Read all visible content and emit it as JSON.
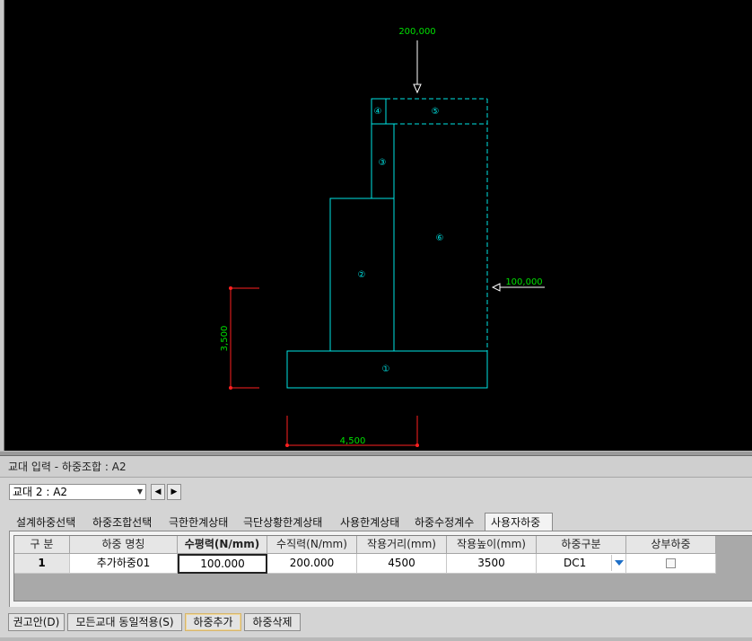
{
  "drawing": {
    "top_load": "200,000",
    "side_load": "100,000",
    "height_dim": "3,500",
    "width_dim": "4,500",
    "section_labels": [
      "①",
      "②",
      "③",
      "④",
      "⑤",
      "⑥"
    ],
    "colors": {
      "structure": "#00e5e5",
      "dimension": "#ff2020",
      "dimension_text": "#00e000",
      "load_arrow": "#ffffff"
    }
  },
  "panel": {
    "title": "교대 입력 - 하중조합 : A2",
    "abutment_select": "교대 2 : A2",
    "prev_icon": "triangle-left-icon",
    "next_icon": "triangle-right-icon"
  },
  "tabs": [
    {
      "label": "설계하중선택",
      "active": false
    },
    {
      "label": "하중조합선택",
      "active": false
    },
    {
      "label": "극한한계상태",
      "active": false
    },
    {
      "label": "극단상황한계상태",
      "active": false
    },
    {
      "label": "사용한계상태",
      "active": false
    },
    {
      "label": "하중수정계수",
      "active": false
    },
    {
      "label": "사용자하중",
      "active": true
    }
  ],
  "table": {
    "columns": [
      "구 분",
      "하중 명칭",
      "수평력(N/mm)",
      "수직력(N/mm)",
      "작용거리(mm)",
      "작용높이(mm)",
      "하중구분",
      "상부하중"
    ],
    "rows": [
      {
        "no": "1",
        "name": "추가하중01",
        "horizontal": "100.000",
        "vertical": "200.000",
        "distance": "4500",
        "height": "3500",
        "type": "DC1",
        "upper": false
      }
    ]
  },
  "buttons": {
    "recommend": "권고안(D)",
    "apply_all": "모든교대 동일적용(S)",
    "add_load": "하중추가",
    "delete_load": "하중삭제"
  }
}
